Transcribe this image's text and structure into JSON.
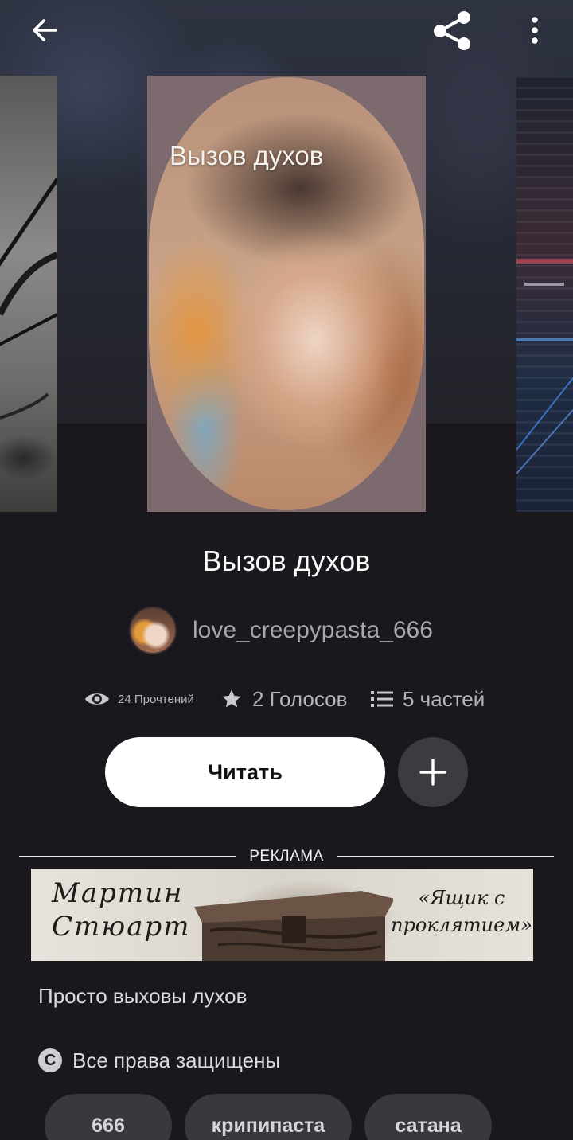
{
  "topbar": {
    "back_icon": "arrow-left-icon",
    "share_icon": "share-icon",
    "more_icon": "more-vertical-icon"
  },
  "cover": {
    "title": "Вызов духов"
  },
  "story": {
    "title": "Вызов духов",
    "author": "love_creepypasta_666"
  },
  "stats": {
    "reads_label": "24 Прочтений",
    "votes_label": "2 Голосов",
    "parts_label": "5 частей"
  },
  "actions": {
    "read_label": "Читать",
    "add_icon": "plus-icon"
  },
  "ad": {
    "label": "РЕКЛАМА",
    "author_line1": "Мартин",
    "author_line2": "Стюарт",
    "book_line1": "«Ящик с",
    "book_line2": "проклятием»"
  },
  "description": "Просто выховы лухов",
  "copyright": {
    "symbol": "C",
    "text": "Все права защищены"
  },
  "tags": [
    "666",
    "крипипаста",
    "сатана"
  ],
  "colors": {
    "background": "#1a181c",
    "button_primary": "#ffffff",
    "button_secondary": "#3d3b40",
    "tag_bg": "#3a383c"
  }
}
